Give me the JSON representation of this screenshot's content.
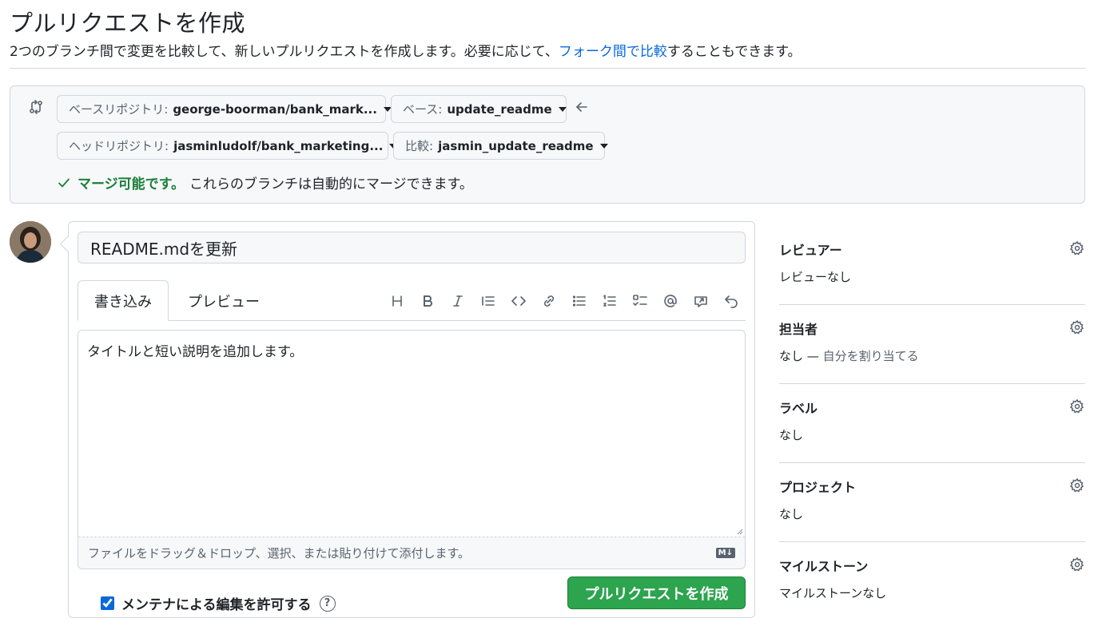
{
  "header": {
    "title": "プルリクエストを作成",
    "subtitle_before": "2つのブランチ間で変更を比較して、新しいプルリクエストを作成します。必要に応じて、",
    "subtitle_link": "フォーク間で比較",
    "subtitle_after": "することもできます。"
  },
  "compare": {
    "base_repo_label": "ベースリポジトリ:",
    "base_repo_value": "george-boorman/bank_mark...",
    "base_label": "ベース:",
    "base_value": "update_readme",
    "head_repo_label": "ヘッドリポジトリ:",
    "head_repo_value": "jasminludolf/bank_marketing...",
    "compare_label": "比較:",
    "compare_value": "jasmin_update_readme",
    "merge_ok": "マージ可能です。",
    "merge_msg": "これらのブランチは自動的にマージできます。"
  },
  "form": {
    "title_value": "README.mdを更新",
    "tab_write": "書き込み",
    "tab_preview": "プレビュー",
    "toolbar": [
      "heading-icon",
      "bold-icon",
      "italic-icon",
      "quote-icon",
      "code-icon",
      "link-icon",
      "unordered-list-icon",
      "ordered-list-icon",
      "task-list-icon",
      "mention-icon",
      "reference-icon",
      "undo-icon"
    ],
    "body_text": "タイトルと短い説明を追加します。",
    "attach_hint": "ファイルをドラッグ＆ドロップ、選択、または貼り付けて添付します。",
    "markdown_badge": "M↓",
    "maintainer_label": "メンテナによる編集を許可する",
    "help_symbol": "?",
    "create_button": "プルリクエストを作成"
  },
  "sidebar": {
    "reviewers_title": "レビュアー",
    "reviewers_value": "レビューなし",
    "assignees_title": "担当者",
    "assignees_value": "なし —",
    "assignees_link": "自分を割り当てる",
    "labels_title": "ラベル",
    "labels_value": "なし",
    "projects_title": "プロジェクト",
    "projects_value": "なし",
    "milestone_title": "マイルストーン",
    "milestone_value": "マイルストーンなし"
  },
  "colors": {
    "link": "#0969da",
    "success": "#1a7f37",
    "button_green": "#2da44e",
    "border": "#d0d7de",
    "muted": "#59636e"
  }
}
